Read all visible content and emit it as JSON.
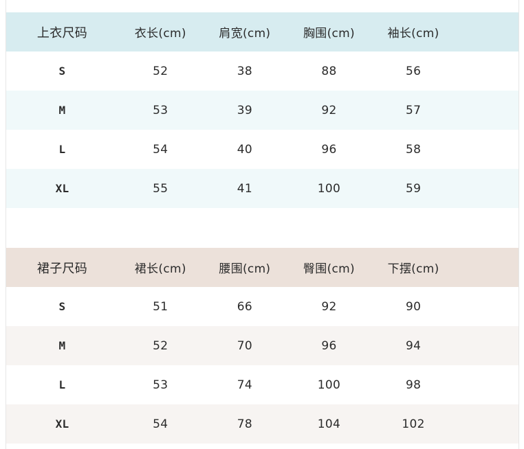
{
  "top_table": {
    "headers": [
      "上衣尺码",
      "衣长(cm)",
      "肩宽(cm)",
      "胸围(cm)",
      "袖长(cm)"
    ],
    "rows": [
      [
        "S",
        "52",
        "38",
        "88",
        "56"
      ],
      [
        "M",
        "53",
        "39",
        "92",
        "57"
      ],
      [
        "L",
        "54",
        "40",
        "96",
        "58"
      ],
      [
        "XL",
        "55",
        "41",
        "100",
        "59"
      ]
    ]
  },
  "bottom_table": {
    "headers": [
      "裙子尺码",
      "裙长(cm)",
      "腰围(cm)",
      "臀围(cm)",
      "下摆(cm)"
    ],
    "rows": [
      [
        "S",
        "51",
        "66",
        "92",
        "90"
      ],
      [
        "M",
        "52",
        "70",
        "96",
        "94"
      ],
      [
        "L",
        "53",
        "74",
        "100",
        "98"
      ],
      [
        "XL",
        "54",
        "78",
        "104",
        "102"
      ]
    ]
  },
  "colors": {
    "top_header_bg": "#d7ecf0",
    "top_alt_row_bg": "#f0f9fa",
    "bottom_header_bg": "#ece1da",
    "bottom_alt_row_bg": "#f7f4f2",
    "text": "#2b2b2b"
  }
}
